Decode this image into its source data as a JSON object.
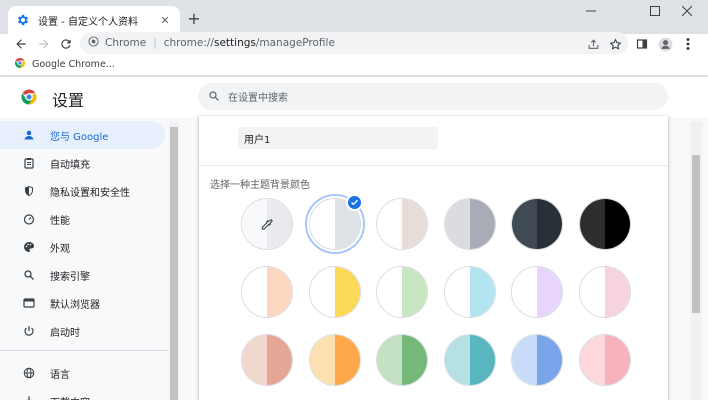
{
  "tab": {
    "title": "设置 - 自定义个人资料",
    "close_icon": "close-icon"
  },
  "new_tab_label": "+",
  "window_controls": [
    "minimize-icon",
    "maximize-icon",
    "close-icon"
  ],
  "toolbar": {
    "site_label": "Chrome",
    "url_prefix": "chrome://",
    "url_host": "settings",
    "url_path": "/manageProfile"
  },
  "bookmarks": [
    {
      "label": "Google Chrome..."
    }
  ],
  "settings": {
    "title": "设置",
    "search_placeholder": "在设置中搜索"
  },
  "sidebar": {
    "items": [
      {
        "label": "您与 Google",
        "icon": "person-icon",
        "active": true
      },
      {
        "label": "自动填充",
        "icon": "clipboard-icon"
      },
      {
        "label": "隐私设置和安全性",
        "icon": "shield-icon"
      },
      {
        "label": "性能",
        "icon": "speedometer-icon"
      },
      {
        "label": "外观",
        "icon": "palette-icon"
      },
      {
        "label": "搜索引擎",
        "icon": "search-icon"
      },
      {
        "label": "默认浏览器",
        "icon": "browser-icon"
      },
      {
        "label": "启动时",
        "icon": "power-icon"
      },
      {
        "label": "语言",
        "icon": "globe-icon"
      },
      {
        "label": "下载内容",
        "icon": "download-icon"
      }
    ]
  },
  "profile": {
    "name_value": "用户1",
    "color_heading": "选择一种主题背景颜色",
    "swatches": [
      {
        "left": "#f8f9fa",
        "right": "#e8eaed",
        "picker": true
      },
      {
        "left": "#ffffff",
        "right": "#dee1e6",
        "selected": true
      },
      {
        "left": "#ffffff",
        "right": "#e6ddd8"
      },
      {
        "left": "#dadce0",
        "right": "#a9abb5"
      },
      {
        "left": "#3f4a55",
        "right": "#2a3038"
      },
      {
        "left": "#2d2d2d",
        "right": "#000000"
      },
      {
        "left": "#ffffff",
        "right": "#fdd6c1"
      },
      {
        "left": "#ffffff",
        "right": "#fdd95a"
      },
      {
        "left": "#ffffff",
        "right": "#c8e6c0"
      },
      {
        "left": "#ffffff",
        "right": "#b3e5f0"
      },
      {
        "left": "#ffffff",
        "right": "#e9d5fb"
      },
      {
        "left": "#ffffff",
        "right": "#f7d2e0"
      },
      {
        "left": "#f1d8ce",
        "right": "#e3a697"
      },
      {
        "left": "#fde0b0",
        "right": "#fda94b"
      },
      {
        "left": "#c3e2c3",
        "right": "#74b87a"
      },
      {
        "left": "#b5e1e5",
        "right": "#58b6c1"
      },
      {
        "left": "#c8dbf8",
        "right": "#7ba5ea"
      },
      {
        "left": "#fcd7dc",
        "right": "#f7b3bd"
      }
    ]
  },
  "colors": {
    "accent": "#1a73e8",
    "active_nav_bg": "#e8f0fe",
    "active_nav_text": "#1967d2"
  }
}
